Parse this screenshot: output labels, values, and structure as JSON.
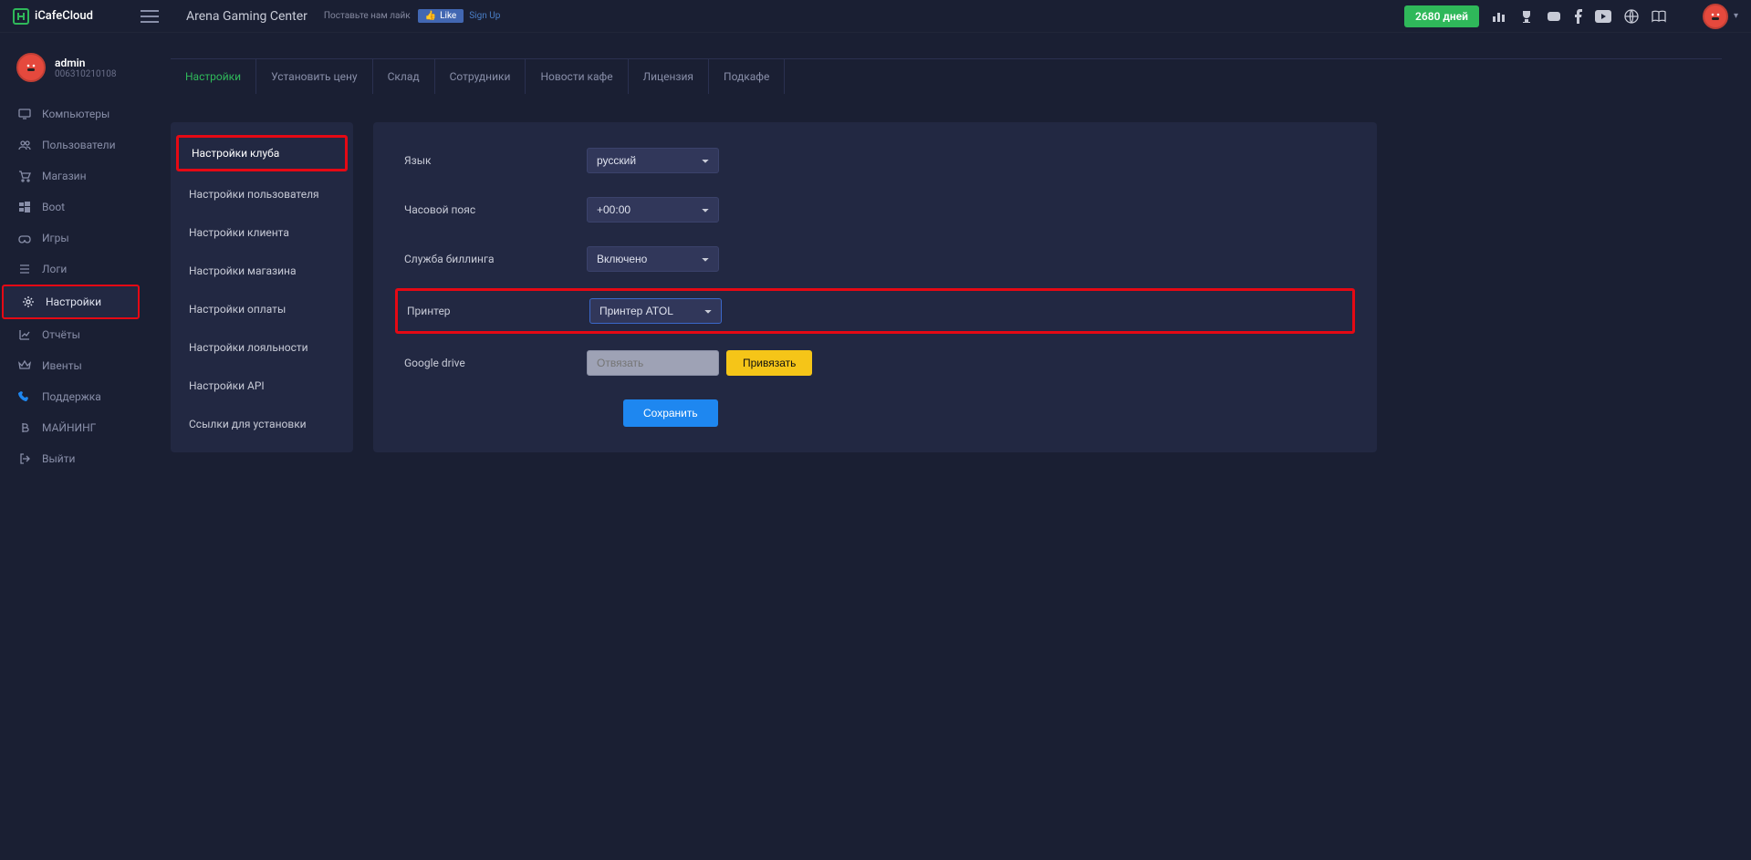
{
  "brand": "iCafeCloud",
  "center_name": "Arena Gaming Center",
  "like_us_label": "Поставьте нам лайк",
  "fb_like": "Like",
  "fb_signup": "Sign Up",
  "days_badge": "2680 дней",
  "user": {
    "name": "admin",
    "id": "006310210108"
  },
  "nav": {
    "computers": "Компьютеры",
    "users": "Пользователи",
    "shop": "Магазин",
    "boot": "Boot",
    "games": "Игры",
    "logs": "Логи",
    "settings": "Настройки",
    "reports": "Отчёты",
    "events": "Ивенты",
    "support": "Поддержка",
    "mining": "МАЙНИНГ",
    "logout": "Выйти"
  },
  "tabs": {
    "settings": "Настройки",
    "set_price": "Установить цену",
    "stock": "Склад",
    "staff": "Сотрудники",
    "news": "Новости кафе",
    "license": "Лицензия",
    "subcafe": "Подкафе"
  },
  "sub": {
    "club": "Настройки клуба",
    "user": "Настройки пользователя",
    "client": "Настройки клиента",
    "shop": "Настройки магазина",
    "payment": "Настройки оплаты",
    "loyalty": "Настройки лояльности",
    "api": "Настройки API",
    "links": "Ссылки для установки"
  },
  "form": {
    "lang_label": "Язык",
    "lang_value": "русский",
    "tz_label": "Часовой пояс",
    "tz_value": "+00:00",
    "billing_label": "Служба биллинга",
    "billing_value": "Включено",
    "printer_label": "Принтер",
    "printer_value": "Принтер ATOL",
    "gdrive_label": "Google drive",
    "gdrive_placeholder": "Отвязать",
    "gdrive_bind": "Привязать",
    "save": "Сохранить"
  }
}
